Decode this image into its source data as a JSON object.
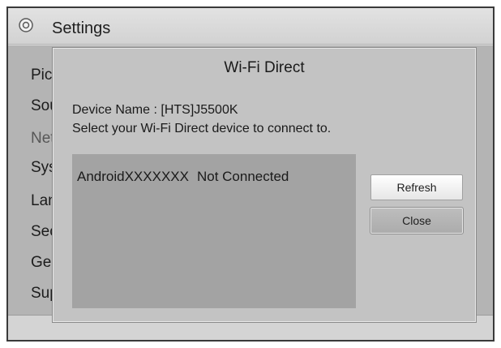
{
  "header": {
    "title": "Settings",
    "icon": "settings-gear-icon"
  },
  "menu": {
    "items": [
      {
        "label": "Picture",
        "state": "normal"
      },
      {
        "label": "Sound",
        "state": "normal"
      },
      {
        "label": "Network",
        "state": "dimmed"
      },
      {
        "label": "System",
        "state": "normal"
      },
      {
        "label": "Language",
        "state": "normal"
      },
      {
        "label": "Security",
        "state": "normal"
      },
      {
        "label": "General",
        "state": "normal"
      },
      {
        "label": "Support",
        "state": "normal"
      }
    ]
  },
  "dialog": {
    "title": "Wi-Fi Direct",
    "device_name": "Device Name : [HTS]J5500K",
    "instruction": "Select your Wi-Fi Direct device to connect to.",
    "devices": [
      {
        "name": "AndroidXXXXXXX",
        "status": "Not Connected"
      }
    ],
    "buttons": {
      "refresh": "Refresh",
      "close": "Close"
    }
  },
  "colors": {
    "background": "#dcdcdc",
    "dialog": "#c3c3c3",
    "list": "#a3a3a3",
    "selected_button": "#ffffff"
  }
}
